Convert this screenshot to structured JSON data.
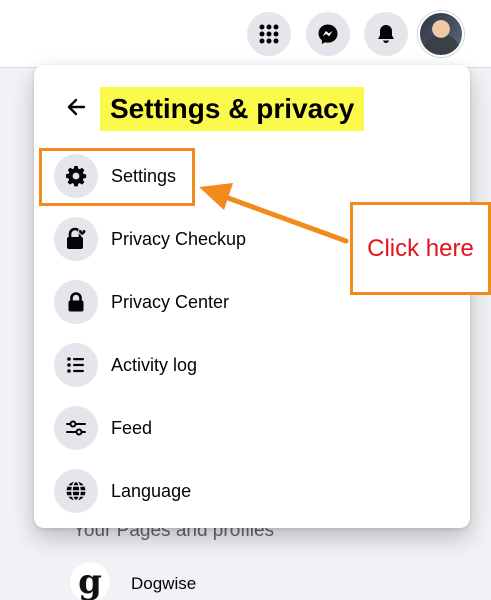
{
  "topbar": {
    "icons": [
      "menu-grid-icon",
      "messenger-icon",
      "bell-icon"
    ],
    "avatar": "profile-avatar"
  },
  "menu": {
    "title": "Settings & privacy",
    "items": [
      {
        "label": "Settings",
        "icon": "gear-icon"
      },
      {
        "label": "Privacy Checkup",
        "icon": "lock-heart-icon"
      },
      {
        "label": "Privacy Center",
        "icon": "lock-icon"
      },
      {
        "label": "Activity log",
        "icon": "list-icon"
      },
      {
        "label": "Feed",
        "icon": "sliders-icon"
      },
      {
        "label": "Language",
        "icon": "globe-icon"
      }
    ]
  },
  "background": {
    "section_title": "Your Pages and profiles",
    "pages": [
      {
        "name": "Dogwise",
        "logo_letter": "g"
      }
    ]
  },
  "annotation": {
    "callout_text": "Click here",
    "color": "#f28a1c",
    "text_color": "#e5121a",
    "title_highlight": "#fbfa4c"
  }
}
